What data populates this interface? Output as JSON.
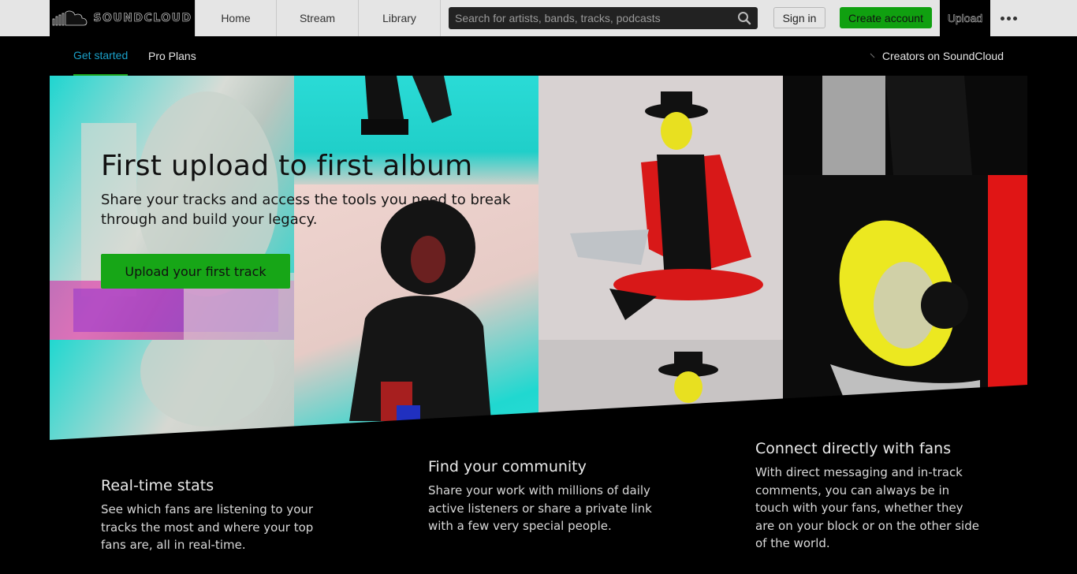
{
  "header": {
    "logo_text": "SOUNDCLOUD",
    "nav": [
      {
        "label": "Home"
      },
      {
        "label": "Stream"
      },
      {
        "label": "Library"
      }
    ],
    "search": {
      "placeholder": "Search for artists, bands, tracks, podcasts",
      "value": ""
    },
    "sign_in": "Sign in",
    "create_account": "Create account",
    "upload": "Upload",
    "more_icon": "more-dots-icon"
  },
  "subnav": {
    "tabs": [
      {
        "label": "Get started",
        "active": true
      },
      {
        "label": "Pro Plans",
        "active": false
      }
    ],
    "creators_link": "Creators on SoundCloud"
  },
  "hero": {
    "title": "First upload to first album",
    "subtitle": "Share your tracks and access the tools you need to break through and build your legacy.",
    "cta": "Upload your first track"
  },
  "features": [
    {
      "title": "Real-time stats",
      "text": "See which fans are listening to your tracks the most and where your top fans are, all in real-time."
    },
    {
      "title": "Find your community",
      "text": "Share your work with millions of daily active listeners or share a private link with a few very special people."
    },
    {
      "title": "Connect directly with fans",
      "text": "With direct messaging and in-track comments, you can always be in touch with your fans, whether they are on your block or on the other side of the world."
    }
  ],
  "colors": {
    "accent_green": "#17a617",
    "active_tab_text": "#1aa0c8",
    "header_bg": "#e5e5e5",
    "page_bg": "#000000"
  }
}
